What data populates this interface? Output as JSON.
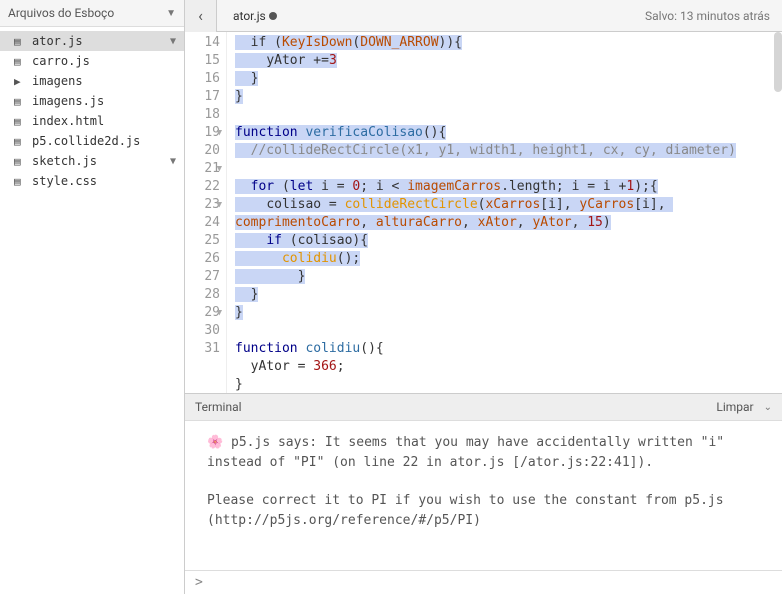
{
  "sidebar": {
    "title": "Arquivos do Esboço",
    "items": [
      {
        "icon": "▤",
        "name": "ator.js",
        "active": true,
        "hasMore": true
      },
      {
        "icon": "▤",
        "name": "carro.js"
      },
      {
        "icon": "▶",
        "name": "imagens"
      },
      {
        "icon": "▤",
        "name": "imagens.js"
      },
      {
        "icon": "▤",
        "name": "index.html"
      },
      {
        "icon": "▤",
        "name": "p5.collide2d.js"
      },
      {
        "icon": "▤",
        "name": "sketch.js",
        "hasMore": true
      },
      {
        "icon": "▤",
        "name": "style.css"
      }
    ]
  },
  "tab": {
    "name": "ator.js",
    "dirty": true
  },
  "saved": "Salvo: 13 minutos atrás",
  "terminal": {
    "title": "Terminal",
    "clear": "Limpar",
    "msg1": "🌸 p5.js says: It seems that you may have accidentally written \"i\" instead of \"PI\" (on line 22 in ator.js [/ator.js:22:41]).",
    "msg2": "Please correct it to PI if you wish to use the constant from p5.js (http://p5js.org/reference/#/p5/PI)",
    "prompt": ">"
  },
  "code": {
    "lines": [
      {
        "n": 14,
        "fold": "",
        "html": "<span class='hl'>  if (<span class='id2'>KeyIsDown</span>(<span class='id2'>DOWN_ARROW</span>)){</span>"
      },
      {
        "n": 15,
        "fold": "",
        "html": "<span class='hl'>    yAtor +=<span class='num'>3</span></span>"
      },
      {
        "n": 16,
        "fold": "",
        "html": "<span class='hl'>  }</span>"
      },
      {
        "n": 17,
        "fold": "",
        "html": "<span class='hl'>}</span>"
      },
      {
        "n": 18,
        "fold": "",
        "html": ""
      },
      {
        "n": 19,
        "fold": "▼",
        "html": "<span class='hl'><span class='kw'>function</span> <span class='fn'>verificaColisao</span>(){</span>"
      },
      {
        "n": 20,
        "fold": "",
        "html": "<span class='hl'>  <span class='cm'>//collideRectCircle(x1, y1, width1, height1, cx, cy, diameter)</span></span>"
      },
      {
        "n": 21,
        "fold": "▼",
        "html": "<span class='hl'>  <span class='kw'>for</span> (<span class='kw'>let</span> i = <span class='num'>0</span>; i &lt; <span class='id2'>imagemCarros</span>.length; i = i +<span class='num'>1</span>);{</span>"
      },
      {
        "n": 22,
        "fold": "",
        "html": "<span class='hl'>    colisao = <span class='fn2'>collideRectCircle</span>(<span class='id2'>xCarros</span>[i], <span class='id2'>yCarros</span>[i], <span class='id2'>comprimentoCarro</span>, <span class='id2'>alturaCarro</span>, <span class='id2'>xAtor</span>, <span class='id2'>yAtor</span>, <span class='num'>15</span>)</span>"
      },
      {
        "n": 23,
        "fold": "▼",
        "html": "<span class='hl'>    <span class='kw'>if</span> (colisao){</span>"
      },
      {
        "n": 24,
        "fold": "",
        "html": "<span class='hl'>      <span class='fn2'>colidiu</span>();</span>"
      },
      {
        "n": 25,
        "fold": "",
        "html": "<span class='hl'>        }</span>"
      },
      {
        "n": 26,
        "fold": "",
        "html": "<span class='hl'>  }</span>"
      },
      {
        "n": 27,
        "fold": "",
        "html": "<span class='hl'>}</span>"
      },
      {
        "n": 28,
        "fold": "",
        "html": ""
      },
      {
        "n": 29,
        "fold": "▼",
        "html": "<span class='kw'>function</span> <span class='fn'>colidiu</span>(){"
      },
      {
        "n": 30,
        "fold": "",
        "html": "  yAtor = <span class='num'>366</span>;"
      },
      {
        "n": 31,
        "fold": "",
        "html": "}"
      }
    ]
  }
}
